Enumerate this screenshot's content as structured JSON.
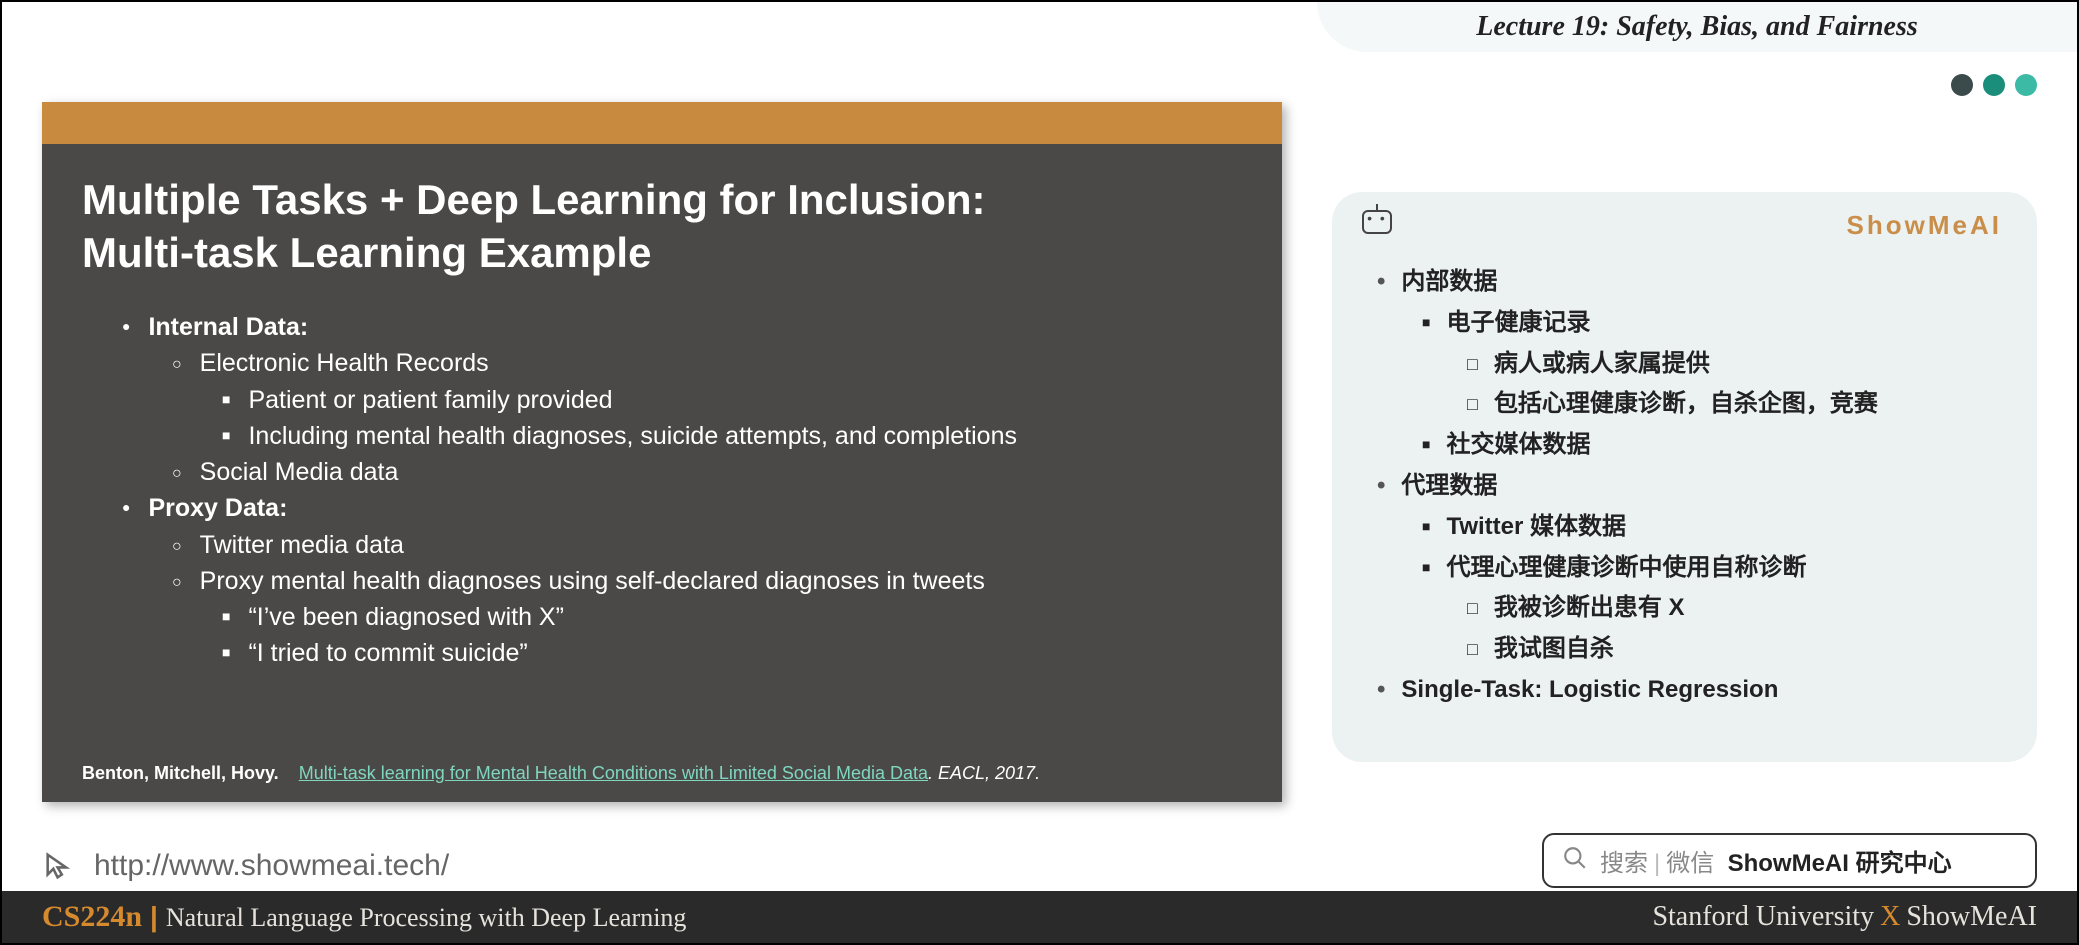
{
  "header": {
    "lecture_title": "Lecture 19: Safety, Bias, and Fairness"
  },
  "slide": {
    "title_line1": "Multiple Tasks + Deep Learning for Inclusion:",
    "title_line2": "Multi-task Learning Example",
    "bullets": {
      "internal_label": "Internal Data:",
      "ehr": "Electronic Health Records",
      "ehr_sub1": "Patient or patient family provided",
      "ehr_sub2": "Including mental health diagnoses, suicide attempts, and completions",
      "social": "Social Media data",
      "proxy_label": "Proxy Data:",
      "twitter": "Twitter media data",
      "proxy_diag": "Proxy mental health diagnoses using self-declared diagnoses in tweets",
      "quote1": "“I’ve been diagnosed with X”",
      "quote2": "“I tried to commit suicide”"
    },
    "citation": {
      "authors": "Benton, Mitchell, Hovy.",
      "link_text": "Multi-task learning for Mental Health Conditions with Limited Social Media Data",
      "venue": ". EACL, 2017."
    }
  },
  "notes": {
    "brand": "ShowMeAI",
    "items": {
      "internal": "内部数据",
      "ehr": "电子健康记录",
      "ehr_sub1": "病人或病人家属提供",
      "ehr_sub2": "包括心理健康诊断，自杀企图，竞赛",
      "social": "社交媒体数据",
      "proxy": "代理数据",
      "twitter": "Twitter 媒体数据",
      "proxy_diag": "代理心理健康诊断中使用自称诊断",
      "quote1": "我被诊断出患有 X",
      "quote2": "我试图自杀",
      "single_task": "Single-Task: Logistic Regression"
    }
  },
  "url": "http://www.showmeai.tech/",
  "search": {
    "hint1": "搜索",
    "hint2": "微信",
    "bold": "ShowMeAI 研究中心"
  },
  "footer": {
    "course_code": "CS224n",
    "course_name": "Natural Language Processing with Deep Learning",
    "uni": "Stanford University",
    "brand": "ShowMeAI"
  }
}
